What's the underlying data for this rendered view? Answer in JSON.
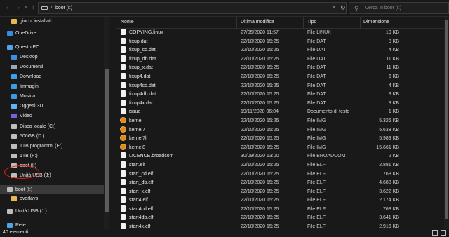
{
  "address": {
    "path": "boot (I:)",
    "search_placeholder": "Cerca in boot (I:)"
  },
  "sidebar": {
    "items": [
      {
        "label": "giochi installati",
        "icon": "folder-icon",
        "color": "#e8b84a"
      },
      {
        "label": "OneDrive",
        "icon": "onedrive-icon",
        "color": "#2f8fe0"
      },
      {
        "label": "Questo PC",
        "icon": "pc-icon",
        "color": "#4fa3e8"
      },
      {
        "label": "Desktop",
        "icon": "desktop-folder-icon",
        "color": "#3a8fe0"
      },
      {
        "label": "Documenti",
        "icon": "documents-folder-icon",
        "color": "#9aa7b4"
      },
      {
        "label": "Download",
        "icon": "download-folder-icon",
        "color": "#3aa0e8"
      },
      {
        "label": "Immagini",
        "icon": "pictures-folder-icon",
        "color": "#3a9be0"
      },
      {
        "label": "Musica",
        "icon": "music-folder-icon",
        "color": "#3a9be0"
      },
      {
        "label": "Oggetti 3D",
        "icon": "3d-objects-folder-icon",
        "color": "#5fb3f0"
      },
      {
        "label": "Video",
        "icon": "video-folder-icon",
        "color": "#7c5fd8"
      },
      {
        "label": "Disco locale (C:)",
        "icon": "drive-icon",
        "color": "#bdbdbd"
      },
      {
        "label": "500GB (D:)",
        "icon": "drive-icon",
        "color": "#bdbdbd"
      },
      {
        "label": "1TB programmi (E:)",
        "icon": "drive-icon",
        "color": "#bdbdbd"
      },
      {
        "label": "1TB (F:)",
        "icon": "drive-icon",
        "color": "#bdbdbd"
      },
      {
        "label": "boot (I:)",
        "icon": "usb-drive-icon",
        "color": "#bdbdbd"
      },
      {
        "label": "Unità USB (J:)",
        "icon": "usb-drive-icon",
        "color": "#bdbdbd"
      },
      {
        "label": "boot (I:)",
        "icon": "usb-drive-icon",
        "color": "#bdbdbd"
      },
      {
        "label": "overlays",
        "icon": "folder-icon",
        "color": "#e8b84a"
      },
      {
        "label": "Unità USB (J:)",
        "icon": "usb-drive-icon",
        "color": "#bdbdbd"
      },
      {
        "label": "Rete",
        "icon": "network-icon",
        "color": "#4fa3e8"
      }
    ]
  },
  "columns": {
    "name": "Nome",
    "date": "Ultima modifica",
    "type": "Tipo",
    "size": "Dimensione"
  },
  "files": [
    {
      "name": "COPYING.linux",
      "date": "27/05/2020 11:57",
      "type": "File LINUX",
      "size": "19 KB",
      "icon": "file-icon"
    },
    {
      "name": "fixup.dat",
      "date": "22/10/2020 15:25",
      "type": "File DAT",
      "size": "8 KB",
      "icon": "file-icon"
    },
    {
      "name": "fixup_cd.dat",
      "date": "22/10/2020 15:25",
      "type": "File DAT",
      "size": "4 KB",
      "icon": "file-icon"
    },
    {
      "name": "fixup_db.dat",
      "date": "22/10/2020 15:25",
      "type": "File DAT",
      "size": "11 KB",
      "icon": "file-icon"
    },
    {
      "name": "fixup_x.dat",
      "date": "22/10/2020 15:25",
      "type": "File DAT",
      "size": "11 KB",
      "icon": "file-icon"
    },
    {
      "name": "fixup4.dat",
      "date": "22/10/2020 15:25",
      "type": "File DAT",
      "size": "6 KB",
      "icon": "file-icon"
    },
    {
      "name": "fixup4cd.dat",
      "date": "22/10/2020 15:25",
      "type": "File DAT",
      "size": "4 KB",
      "icon": "file-icon"
    },
    {
      "name": "fixup4db.dat",
      "date": "22/10/2020 15:25",
      "type": "File DAT",
      "size": "9 KB",
      "icon": "file-icon"
    },
    {
      "name": "fixup4x.dat",
      "date": "22/10/2020 15:25",
      "type": "File DAT",
      "size": "9 KB",
      "icon": "file-icon"
    },
    {
      "name": "issue",
      "date": "19/11/2020 06:04",
      "type": "Documento di testo",
      "size": "1 KB",
      "icon": "file-icon"
    },
    {
      "name": "kernel",
      "date": "22/10/2020 15:25",
      "type": "File IMG",
      "size": "5.326 KB",
      "icon": "disk-image-icon"
    },
    {
      "name": "kernel7",
      "date": "22/10/2020 15:25",
      "type": "File IMG",
      "size": "5.638 KB",
      "icon": "disk-image-icon"
    },
    {
      "name": "kernel7l",
      "date": "22/10/2020 15:25",
      "type": "File IMG",
      "size": "5.989 KB",
      "icon": "disk-image-icon"
    },
    {
      "name": "kernel8",
      "date": "22/10/2020 15:25",
      "type": "File IMG",
      "size": "15.661 KB",
      "icon": "disk-image-icon"
    },
    {
      "name": "LICENCE.broadcom",
      "date": "30/09/2020 13:00",
      "type": "File BROADCOM",
      "size": "2 KB",
      "icon": "file-icon"
    },
    {
      "name": "start.elf",
      "date": "22/10/2020 15:25",
      "type": "File ELF",
      "size": "2.881 KB",
      "icon": "file-icon"
    },
    {
      "name": "start_cd.elf",
      "date": "22/10/2020 15:25",
      "type": "File ELF",
      "size": "768 KB",
      "icon": "file-icon"
    },
    {
      "name": "start_db.elf",
      "date": "22/10/2020 15:25",
      "type": "File ELF",
      "size": "4.688 KB",
      "icon": "file-icon"
    },
    {
      "name": "start_x.elf",
      "date": "22/10/2020 15:25",
      "type": "File ELF",
      "size": "3.622 KB",
      "icon": "file-icon"
    },
    {
      "name": "start4.elf",
      "date": "22/10/2020 15:25",
      "type": "File ELF",
      "size": "2.174 KB",
      "icon": "file-icon"
    },
    {
      "name": "start4cd.elf",
      "date": "22/10/2020 15:25",
      "type": "File ELF",
      "size": "768 KB",
      "icon": "file-icon"
    },
    {
      "name": "start4db.elf",
      "date": "22/10/2020 15:25",
      "type": "File ELF",
      "size": "3.641 KB",
      "icon": "file-icon"
    },
    {
      "name": "start4x.elf",
      "date": "22/10/2020 15:25",
      "type": "File ELF",
      "size": "2.916 KB",
      "icon": "file-icon"
    }
  ],
  "status": {
    "count": "40 elementi"
  }
}
